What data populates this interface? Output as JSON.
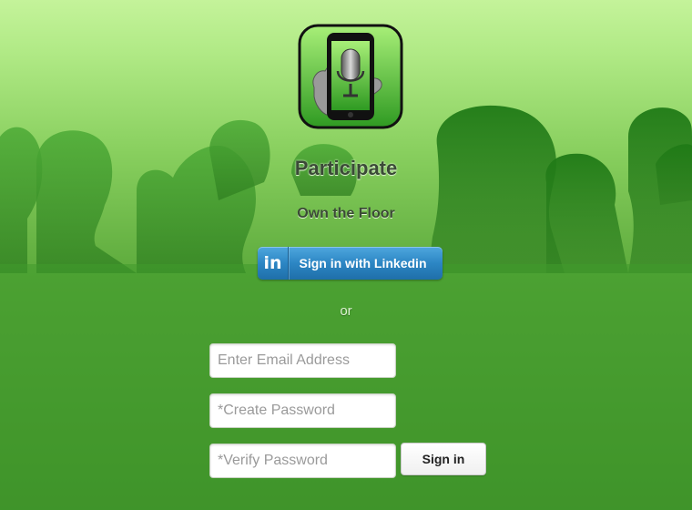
{
  "app": {
    "title": "Participate",
    "subtitle": "Own the Floor",
    "icon": "microphone-phone-icon"
  },
  "linkedin": {
    "logo_text": "in",
    "label": "Sign in with Linkedin",
    "color": "#2c86c4"
  },
  "separator": "or",
  "form": {
    "email_placeholder": "Enter Email Address",
    "email_value": "",
    "create_password_placeholder": "*Create Password",
    "create_password_value": "",
    "verify_password_placeholder": "*Verify Password",
    "verify_password_value": "",
    "submit_label": "Sign in"
  },
  "colors": {
    "background_top": "#c4f39a",
    "background_bottom": "#3f8c28",
    "crowd": "#3f9a2c"
  }
}
